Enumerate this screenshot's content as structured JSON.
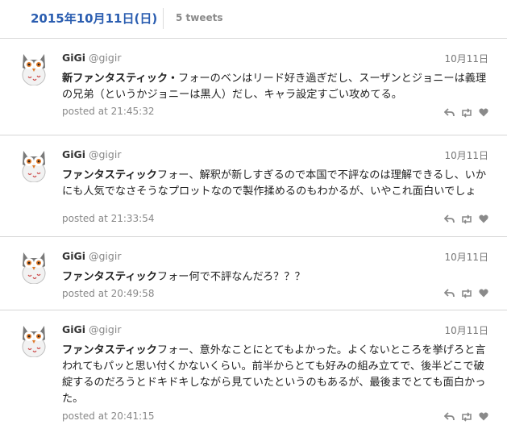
{
  "header": {
    "date": "2015年10月11日(日)",
    "tweet_count": "5 tweets"
  },
  "tweets": [
    {
      "name": "GiGi",
      "handle": "@gigir",
      "date": "10月11日",
      "text_bold": "新ファンタスティック・",
      "text": "フォーのベンはリード好き過ぎだし、スーザンとジョニーは義理の兄弟（というかジョニーは黒人）だし、キャラ設定すごい攻めてる。",
      "posted": "posted at 21:45:32"
    },
    {
      "name": "GiGi",
      "handle": "@gigir",
      "date": "10月11日",
      "text_bold": "ファンタスティック",
      "text": "フォー、解釈が新しすぎるので本国で不評なのは理解できるし、いかにも人気でなさそうなプロットなので製作揉めるのもわかるが、いやこれ面白いでしょ",
      "posted": "posted at 21:33:54"
    },
    {
      "name": "GiGi",
      "handle": "@gigir",
      "date": "10月11日",
      "text_bold": "ファンタスティック",
      "text": "フォー何で不評なんだろ？？？",
      "posted": "posted at 20:49:58"
    },
    {
      "name": "GiGi",
      "handle": "@gigir",
      "date": "10月11日",
      "text_bold": "ファンタスティック",
      "text": "フォー、意外なことにとてもよかった。よくないところを挙げろと言われてもパッと思い付くかないくらい。前半からとても好みの組み立てで、後半どこで破綻するのだろうとドキドキしながら見ていたというのもあるが、最後までとても面白かった。",
      "posted": "posted at 20:41:15"
    }
  ],
  "icons": {
    "reply": "reply-icon",
    "retweet": "retweet-icon",
    "like": "heart-icon",
    "avatar": "owl-avatar"
  },
  "colors": {
    "date_blue": "#2a5db0",
    "muted": "#888888"
  }
}
